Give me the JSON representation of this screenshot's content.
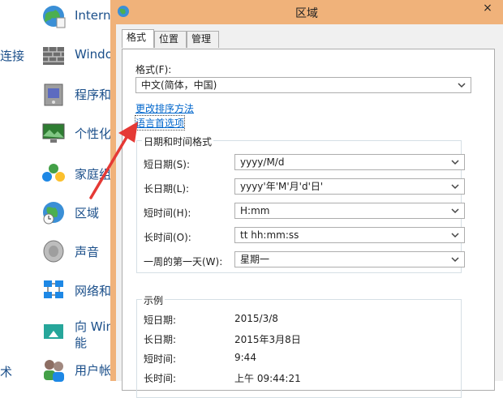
{
  "control_panel": {
    "left_labels": [
      "连接",
      "术"
    ],
    "items": [
      {
        "label": "Intern",
        "icon": "internet-options-icon"
      },
      {
        "label": "Windo",
        "icon": "windows-firewall-icon"
      },
      {
        "label": "程序和",
        "icon": "programs-features-icon"
      },
      {
        "label": "个性化",
        "icon": "personalization-icon"
      },
      {
        "label": "家庭组",
        "icon": "homegroup-icon"
      },
      {
        "label": "区域",
        "icon": "region-icon"
      },
      {
        "label": "声音",
        "icon": "sound-icon"
      },
      {
        "label": "网络和",
        "icon": "network-icon"
      },
      {
        "label": "向 Win",
        "label2": "能",
        "icon": "add-features-icon"
      },
      {
        "label": "用户帐",
        "icon": "user-accounts-icon"
      }
    ]
  },
  "dialog": {
    "title": "区域",
    "close": "×",
    "tabs": [
      "格式",
      "位置",
      "管理"
    ],
    "format_label": "格式(F):",
    "format_value": "中文(简体，中国)",
    "links": {
      "change_sort": "更改排序方法",
      "language_prefs": "语言首选项"
    },
    "datetime_group": {
      "title": "日期和时间格式",
      "rows": [
        {
          "label": "短日期(S):",
          "value": "yyyy/M/d"
        },
        {
          "label": "长日期(L):",
          "value": "yyyy'年'M'月'd'日'"
        },
        {
          "label": "短时间(H):",
          "value": "H:mm"
        },
        {
          "label": "长时间(O):",
          "value": "tt hh:mm:ss"
        },
        {
          "label": "一周的第一天(W):",
          "value": "星期一"
        }
      ]
    },
    "example_group": {
      "title": "示例",
      "rows": [
        {
          "label": "短日期:",
          "value": "2015/3/8"
        },
        {
          "label": "长日期:",
          "value": "2015年3月8日"
        },
        {
          "label": "短时间:",
          "value": "9:44"
        },
        {
          "label": "长时间:",
          "value": "上午 09:44:21"
        }
      ]
    }
  },
  "colors": {
    "dialog_frame": "#f0b27a",
    "link": "#0066cc",
    "arrow": "#e53935"
  }
}
